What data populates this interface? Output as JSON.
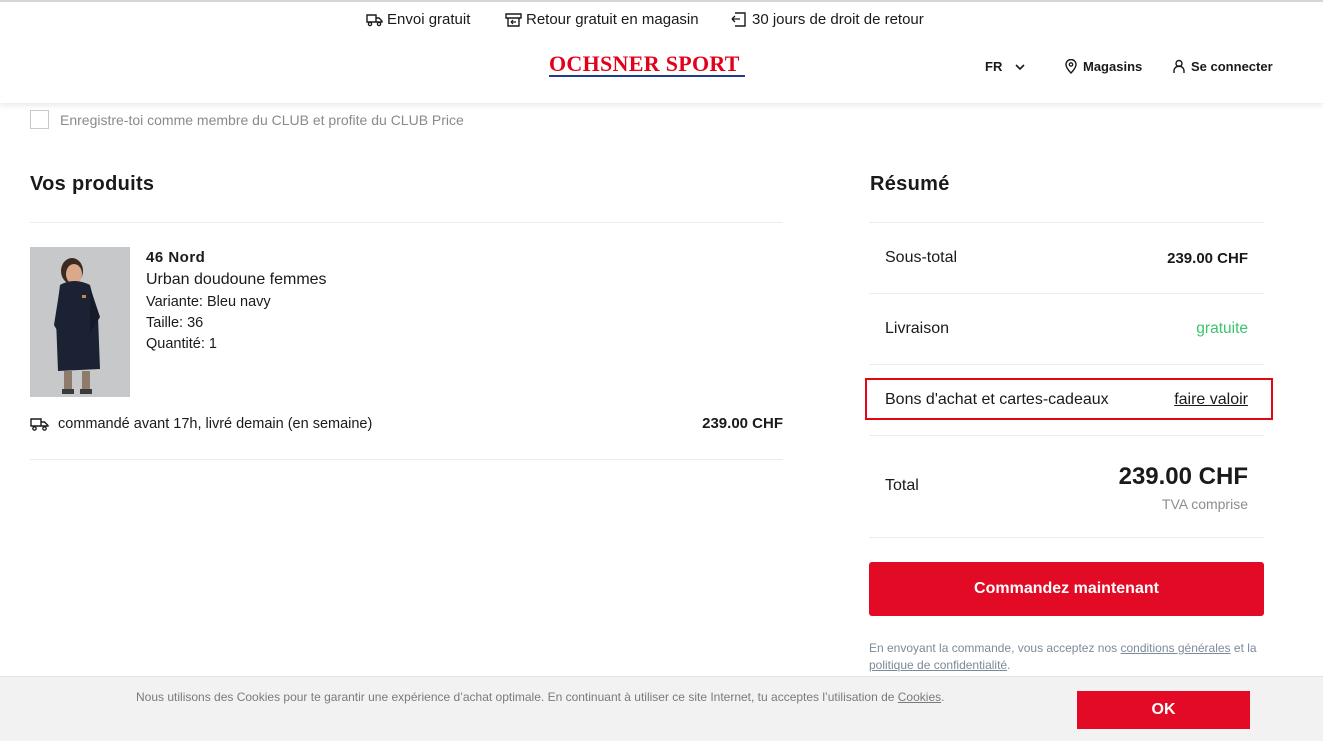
{
  "usps": [
    {
      "icon": "truck-icon",
      "label": "Envoi gratuit"
    },
    {
      "icon": "store-return-icon",
      "label": "Retour gratuit en magasin"
    },
    {
      "icon": "return-calendar-icon",
      "label": "30 jours de droit de retour"
    }
  ],
  "brand": {
    "logo_text": "OCHSNER SPORT",
    "logo_color": "#e3001b",
    "underline_color": "#1d3b8a"
  },
  "nav": {
    "language": "FR",
    "stores": "Magasins",
    "login": "Se connecter"
  },
  "club": {
    "checkbox_label": "Enregistre-toi comme membre du CLUB et profite du CLUB Price",
    "checked": false
  },
  "products": {
    "title": "Vos produits",
    "items": [
      {
        "brand": "46 Nord",
        "name": "Urban doudoune femmes",
        "variant": "Variante: Bleu navy",
        "size": "Taille: 36",
        "quantity": "Quantité: 1",
        "delivery": "commandé avant 17h, livré demain (en semaine)",
        "price": "239.00 CHF"
      }
    ]
  },
  "summary": {
    "title": "Résumé",
    "subtotal_label": "Sous-total",
    "subtotal_value": "239.00 CHF",
    "shipping_label": "Livraison",
    "shipping_value": "gratuite",
    "voucher_label": "Bons d'achat et cartes-cadeaux",
    "voucher_action": "faire valoir",
    "total_label": "Total",
    "total_value": "239.00 CHF",
    "vat_note": "TVA comprise",
    "order_button": "Commandez maintenant",
    "legal_prefix": "En envoyant la commande, vous acceptez nos ",
    "legal_terms": "conditions générales",
    "legal_and": " et la ",
    "legal_privacy": "politique de confidentialité",
    "legal_suffix": "."
  },
  "cookie": {
    "text": "Nous utilisons des Cookies pour te garantir une expérience d’achat optimale. En continuant à utiliser ce site Internet, tu acceptes l’utilisation de ",
    "link": "Cookies",
    "suffix": ".",
    "ok": "OK"
  },
  "colors": {
    "accent": "#e30a25",
    "free": "#3cc46d",
    "highlight": "#e30613"
  }
}
